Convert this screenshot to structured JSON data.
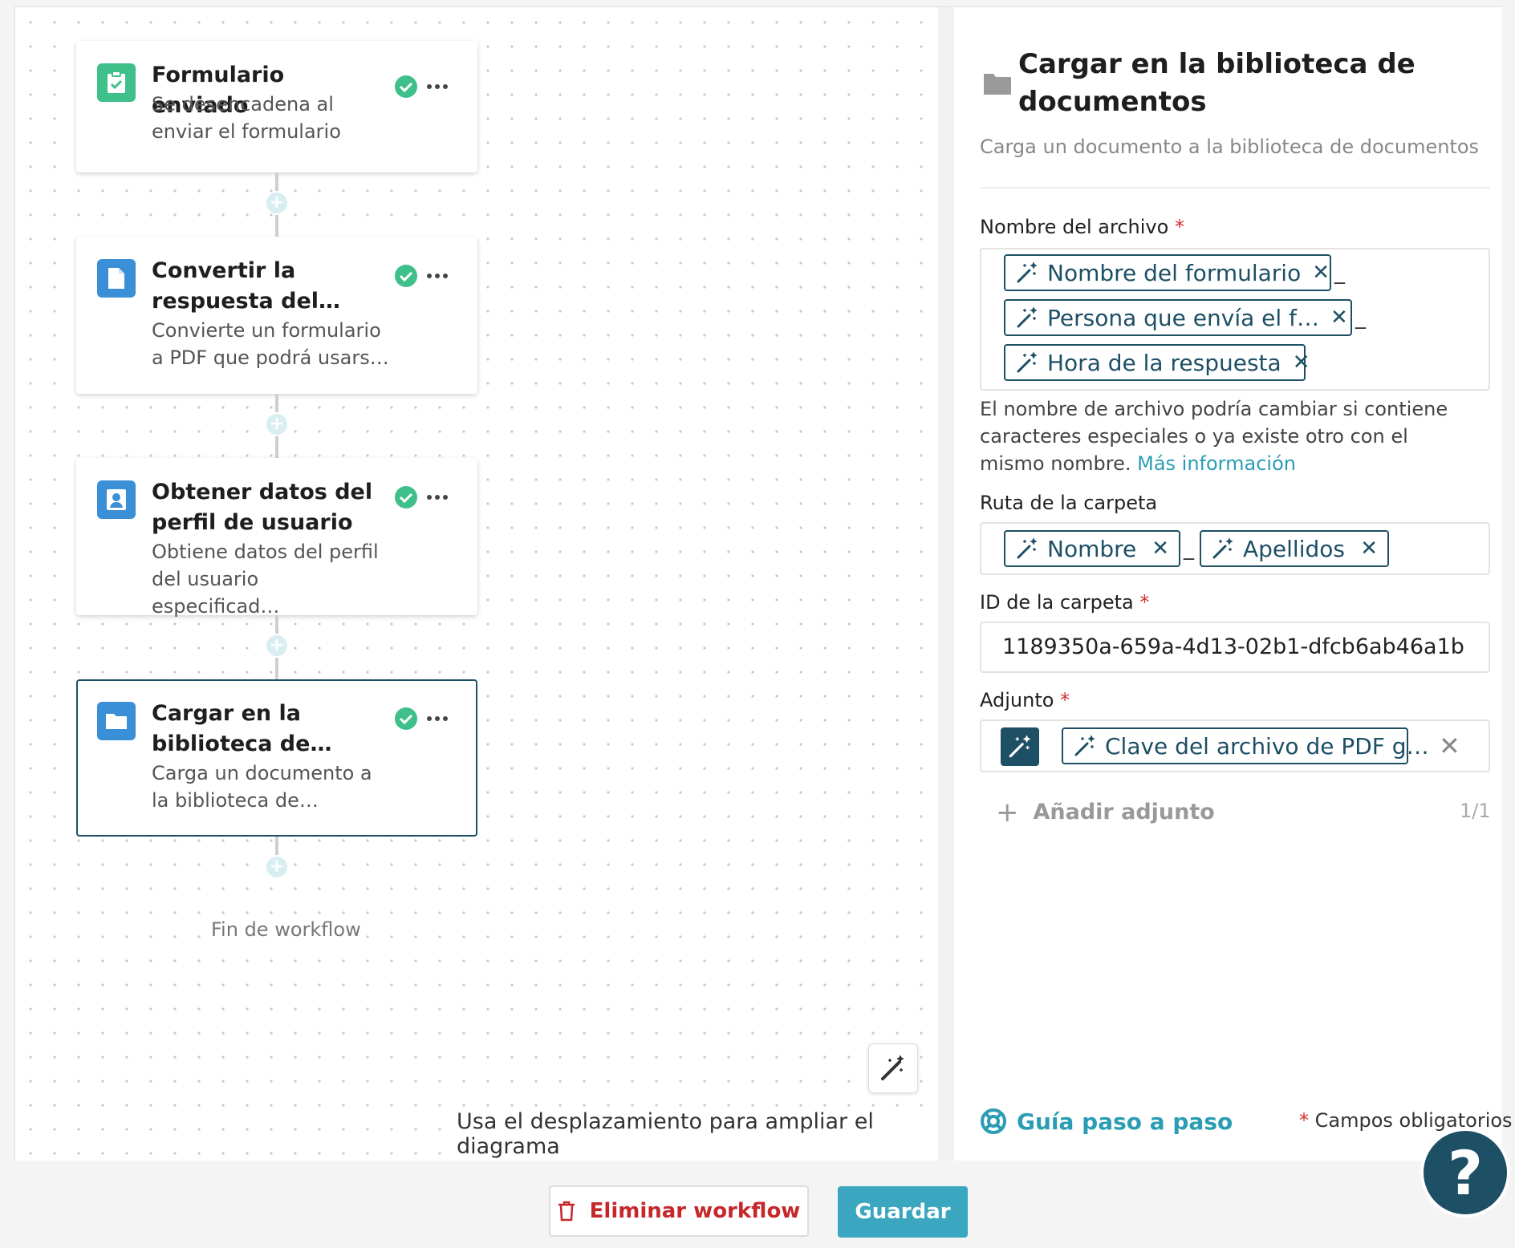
{
  "workflow": {
    "steps": [
      {
        "title": "Formulario enviado",
        "description": "Se desencadena al enviar el formulario",
        "icon": "clipboard-check-icon",
        "color": "#3fbf8a"
      },
      {
        "title": "Convertir la respuesta del…",
        "description": "Convierte un formulario a PDF que podrá usars…",
        "icon": "document-icon",
        "color": "#3b8fd6"
      },
      {
        "title": "Obtener datos del perfil de usuario",
        "description": "Obtiene datos del perfil del usuario especificad…",
        "icon": "user-icon",
        "color": "#3b8fd6"
      },
      {
        "title": "Cargar en la biblioteca de…",
        "description": "Carga un documento a la biblioteca de…",
        "icon": "folder-icon",
        "color": "#3b8fd6"
      }
    ],
    "end_label": "Fin de workflow",
    "zoom_hint": "Usa el desplazamiento para ampliar el diagrama"
  },
  "panel": {
    "title": "Cargar en la biblioteca de documentos",
    "subtitle": "Carga un documento a la biblioteca de documentos",
    "file_name": {
      "label": "Nombre del archivo",
      "required": "*",
      "tokens": [
        "Nombre del formulario",
        "Persona que envía el f…",
        "Hora de la respuesta"
      ],
      "separator": "_",
      "help": "El nombre de archivo podría cambiar si contiene caracteres especiales o ya existe otro con el mismo nombre.",
      "help_link": "Más información"
    },
    "folder_path": {
      "label": "Ruta de la carpeta",
      "tokens": [
        "Nombre",
        "Apellidos"
      ],
      "separator": "_"
    },
    "folder_id": {
      "label": "ID de la carpeta",
      "required": "*",
      "value": "1189350a-659a-4d13-02b1-dfcb6ab46a1b"
    },
    "attachment": {
      "label": "Adjunto",
      "required": "*",
      "token": "Clave del archivo de PDF g…",
      "add_label": "Añadir adjunto",
      "count": "1/1"
    },
    "guide_label": "Guía paso a paso",
    "required_note_star": "*",
    "required_note": "Campos obligatorios"
  },
  "footer": {
    "delete_label": "Eliminar workflow",
    "save_label": "Guardar",
    "help_label": "?"
  }
}
